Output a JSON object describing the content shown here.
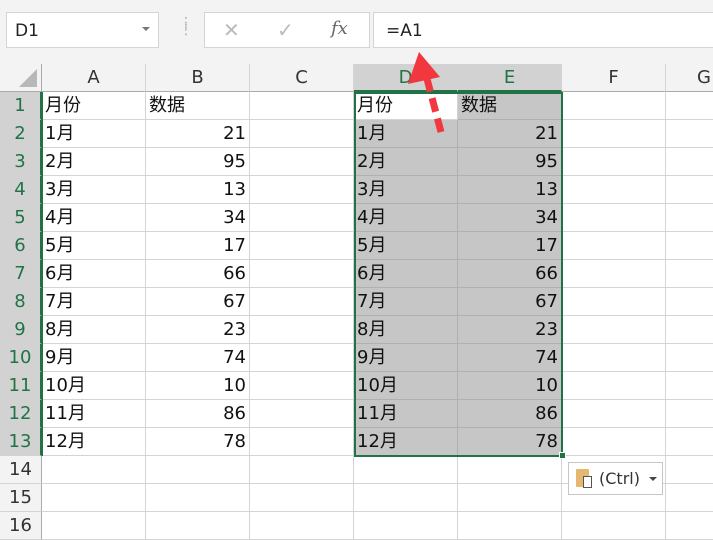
{
  "name_box": "D1",
  "formula_buttons": {
    "cancel": "✕",
    "enter": "✓",
    "fx": "fx"
  },
  "formula": "=A1",
  "columns": [
    "A",
    "B",
    "C",
    "D",
    "E",
    "F",
    "G"
  ],
  "rows": [
    "1",
    "2",
    "3",
    "4",
    "5",
    "6",
    "7",
    "8",
    "9",
    "10",
    "11",
    "12",
    "13",
    "14",
    "15",
    "16"
  ],
  "header": {
    "month": "月份",
    "value": "数据"
  },
  "data": [
    [
      "1月",
      21
    ],
    [
      "2月",
      95
    ],
    [
      "3月",
      13
    ],
    [
      "4月",
      34
    ],
    [
      "5月",
      17
    ],
    [
      "6月",
      66
    ],
    [
      "7月",
      67
    ],
    [
      "8月",
      23
    ],
    [
      "9月",
      74
    ],
    [
      "10月",
      10
    ],
    [
      "11月",
      86
    ],
    [
      "12月",
      78
    ]
  ],
  "paste_options": "(Ctrl)",
  "colors": {
    "accent": "#217346",
    "arrow": "#f0383e",
    "selection": "#c6c6c6"
  }
}
